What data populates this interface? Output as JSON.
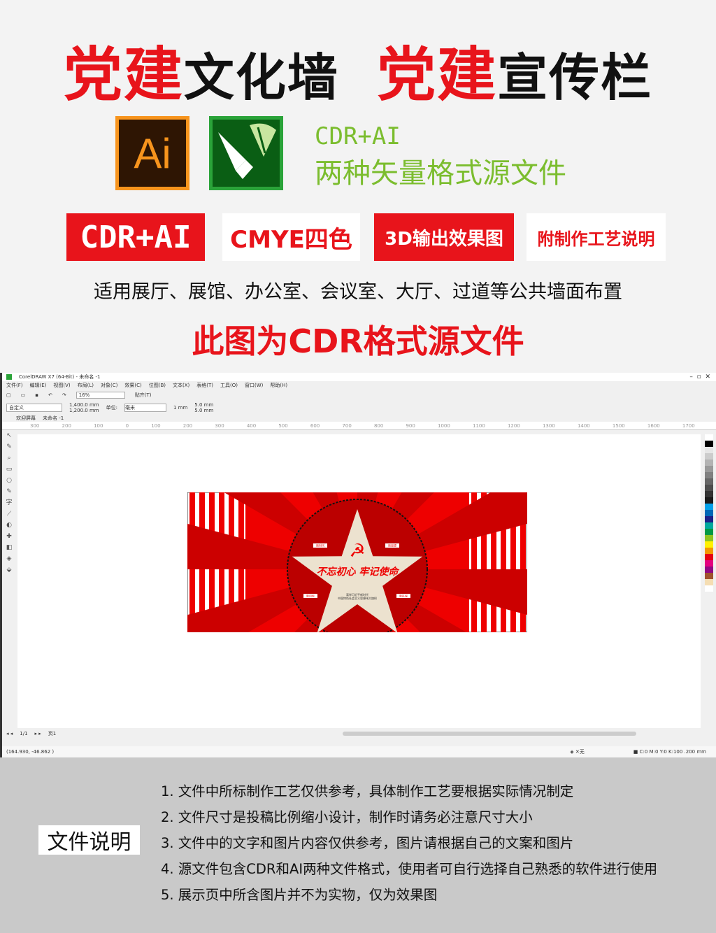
{
  "header": {
    "title_red_1": "党建",
    "title_black_1": "文化墙",
    "title_red_2": "党建",
    "title_black_2": "宣传栏"
  },
  "formats": {
    "ai_icon_label": "Ai",
    "line1": "CDR+AI",
    "line2": "两种矢量格式源文件"
  },
  "badges": [
    "CDR+AI",
    "CMYE四色",
    "3D输出效果图",
    "附制作工艺说明"
  ],
  "usage": "适用展厅、展馆、办公室、会议室、大厅、过道等公共墙面布置",
  "source_note": "此图为CDR格式源文件",
  "coreldraw": {
    "window_title": "CorelDRAW X7 (64-Bit) - 未命名 -1",
    "menu": [
      "文件(F)",
      "编辑(E)",
      "视图(V)",
      "布局(L)",
      "对象(C)",
      "效果(C)",
      "位图(B)",
      "文本(X)",
      "表格(T)",
      "工具(O)",
      "窗口(W)",
      "帮助(H)"
    ],
    "zoom": "16%",
    "snap": "贴齐(T)",
    "page_preset": "自定义",
    "width": "1,400.0 mm",
    "height": "1,200.0 mm",
    "units_label": "单位:",
    "units": "毫米",
    "nudge": "1 mm",
    "dup_x": "5.0 mm",
    "dup_y": "5.0 mm",
    "tabs": [
      "欢迎屏幕",
      "未命名 -1"
    ],
    "ruler": [
      "300",
      "200",
      "100",
      "0",
      "100",
      "200",
      "300",
      "400",
      "500",
      "600",
      "700",
      "800",
      "900",
      "1000",
      "1100",
      "1200",
      "1300",
      "1400",
      "1500",
      "1600",
      "1700"
    ],
    "page_nav": "1/1",
    "page_tab": "页1",
    "coords": "(164.930, -46.862 )",
    "fill_none": "无",
    "outline_info": "C:0 M:0 Y:0 K:100  .200 mm",
    "artwork": {
      "labels": [
        "新时代",
        "新思想",
        "新目标",
        "新征程"
      ],
      "slogan": "不忘初心 牢记使命",
      "subtext_1": "高举习近平新时代",
      "subtext_2": "中国特色社会主义思想伟大旗帜"
    },
    "palette": [
      "#ffffff",
      "#000000",
      "#e6e6e6",
      "#cccccc",
      "#b3b3b3",
      "#999999",
      "#808080",
      "#666666",
      "#4d4d4d",
      "#333333",
      "#1a1a1a",
      "#00a0e9",
      "#0068b7",
      "#1d2088",
      "#00a99d",
      "#009944",
      "#8fc31f",
      "#fff100",
      "#f39800",
      "#e60012",
      "#e4007f",
      "#920783",
      "#a0522d",
      "#f5deb3",
      "#ffffff"
    ]
  },
  "doc_notes": {
    "label": "文件说明",
    "items": [
      "1. 文件中所标制作工艺仅供参考，具体制作工艺要根据实际情况制定",
      "2. 文件尺寸是投稿比例缩小设计，制作时请务必注意尺寸大小",
      "3. 文件中的文字和图片内容仅供参考，图片请根据自己的文案和图片",
      "4. 源文件包含CDR和AI两种文件格式，使用者可自行选择自己熟悉的软件进行使用",
      "5. 展示页中所含图片并不为实物，仅为效果图"
    ]
  },
  "colors": {
    "red": "#e8141b",
    "green": "#7bbd2e",
    "ai_orange": "#f7941d"
  }
}
